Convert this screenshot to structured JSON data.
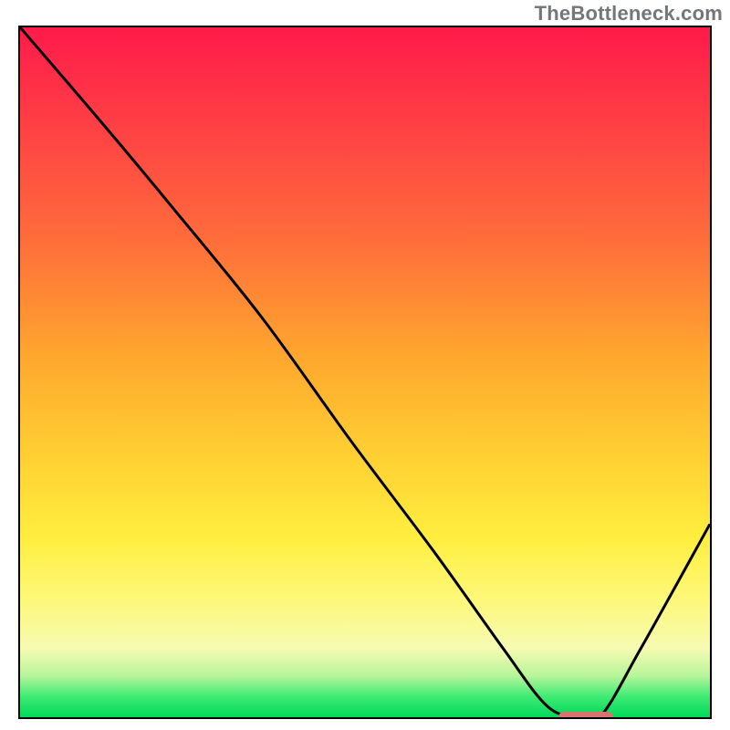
{
  "watermark": "TheBottleneck.com",
  "colors": {
    "curve": "#000000",
    "marker": "#d9746c",
    "border": "#000000"
  },
  "chart_data": {
    "type": "line",
    "title": "",
    "xlabel": "",
    "ylabel": "",
    "xlim": [
      0,
      100
    ],
    "ylim": [
      0,
      100
    ],
    "series": [
      {
        "name": "bottleneck-curve",
        "x": [
          0,
          12,
          22,
          35,
          48,
          60,
          70,
          76,
          80,
          84,
          90,
          100
        ],
        "values": [
          100,
          86,
          74,
          58,
          40,
          24,
          10,
          2,
          0,
          0,
          10,
          28
        ]
      }
    ],
    "markers": [
      {
        "name": "optimal-range",
        "x_start": 78,
        "x_end": 86,
        "y": 0
      }
    ],
    "gradient_stops": [
      {
        "pos": 0,
        "color": "#ff1a4a"
      },
      {
        "pos": 30,
        "color": "#ff6a3b"
      },
      {
        "pos": 63,
        "color": "#ffd233"
      },
      {
        "pos": 83,
        "color": "#fdf87a"
      },
      {
        "pos": 100,
        "color": "#00d85a"
      }
    ]
  }
}
